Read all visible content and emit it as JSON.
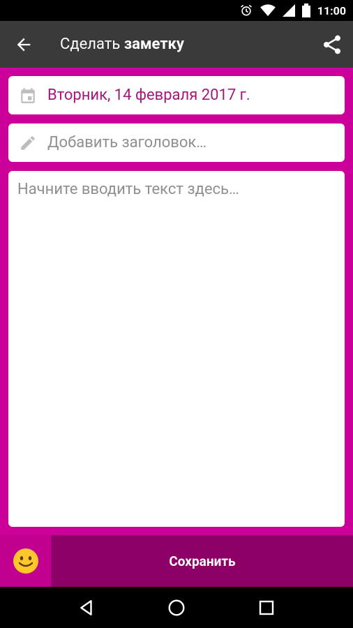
{
  "status_bar": {
    "time": "11:00",
    "icons": [
      "alarm-icon",
      "wifi-icon",
      "signal-icon",
      "battery-icon"
    ]
  },
  "toolbar": {
    "title_prefix": "Сделать ",
    "title_bold": "заметку",
    "back_icon": "arrow-left-icon",
    "share_icon": "share-icon"
  },
  "form": {
    "date_day": "Вторник,",
    "date_rest": " 14 февраля 2017 г.",
    "title_placeholder": "Добавить заголовок…",
    "body_placeholder": "Начните вводить текст здесь…"
  },
  "bottom": {
    "emoji_icon": "smiley-icon",
    "save_label": "Сохранить"
  },
  "colors": {
    "accent": "#cc0099",
    "toolbar": "#3a3a3a",
    "bottom_bar": "#8d0066",
    "date_text": "#a3177f"
  }
}
